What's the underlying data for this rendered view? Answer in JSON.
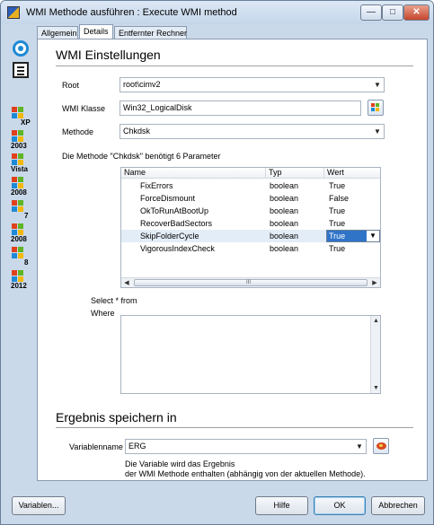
{
  "window": {
    "title": "WMI Methode ausführen : Execute WMI method",
    "minimize_glyph": "—",
    "maximize_glyph": "□",
    "close_glyph": "✕"
  },
  "sidebar": {
    "icons": [
      "circle-icon",
      "list-icon"
    ],
    "os_items": [
      {
        "label": "XP"
      },
      {
        "label": "2003"
      },
      {
        "label": "Vista"
      },
      {
        "label": "2008"
      },
      {
        "label": "7"
      },
      {
        "label": "2008"
      },
      {
        "label": "8"
      },
      {
        "label": "2012"
      }
    ]
  },
  "tabs": [
    {
      "label": "Allgemein"
    },
    {
      "label": "Details"
    },
    {
      "label": "Entfernter Rechner"
    }
  ],
  "active_tab": "Details",
  "wmi": {
    "section_title": "WMI Einstellungen",
    "root_label": "Root",
    "root_value": "root\\cimv2",
    "class_label": "WMI Klasse",
    "class_value": "Win32_LogicalDisk",
    "method_label": "Methode",
    "method_value": "Chkdsk",
    "params_info": "Die Methode \"Chkdsk\" benötigt 6 Parameter"
  },
  "params_table": {
    "columns": [
      "Name",
      "Typ",
      "Wert"
    ],
    "rows": [
      {
        "name": "FixErrors",
        "type": "boolean",
        "value": "True"
      },
      {
        "name": "ForceDismount",
        "type": "boolean",
        "value": "False"
      },
      {
        "name": "OkToRunAtBootUp",
        "type": "boolean",
        "value": "True"
      },
      {
        "name": "RecoverBadSectors",
        "type": "boolean",
        "value": "True"
      },
      {
        "name": "SkipFolderCycle",
        "type": "boolean",
        "value": "True"
      },
      {
        "name": "VigorousIndexCheck",
        "type": "boolean",
        "value": "True"
      }
    ],
    "selected_row": 4,
    "scroll_grip": "III"
  },
  "query": {
    "select_label": "Select * from",
    "where_label": "Where",
    "text": ""
  },
  "result": {
    "section_title": "Ergebnis speichern in",
    "variable_label": "Variablenname",
    "variable_value": "ERG",
    "note_line1": "Die Variable wird das Ergebnis",
    "note_line2": "der WMI Methode enthalten (abhängig von der aktuellen Methode)."
  },
  "footer": {
    "variables_button": "Variablen...",
    "help_button": "Hilfe",
    "ok_button": "OK",
    "cancel_button": "Abbrechen"
  },
  "colors": {
    "selection": "#3074c8",
    "window_frame": "#c9d9ea"
  }
}
